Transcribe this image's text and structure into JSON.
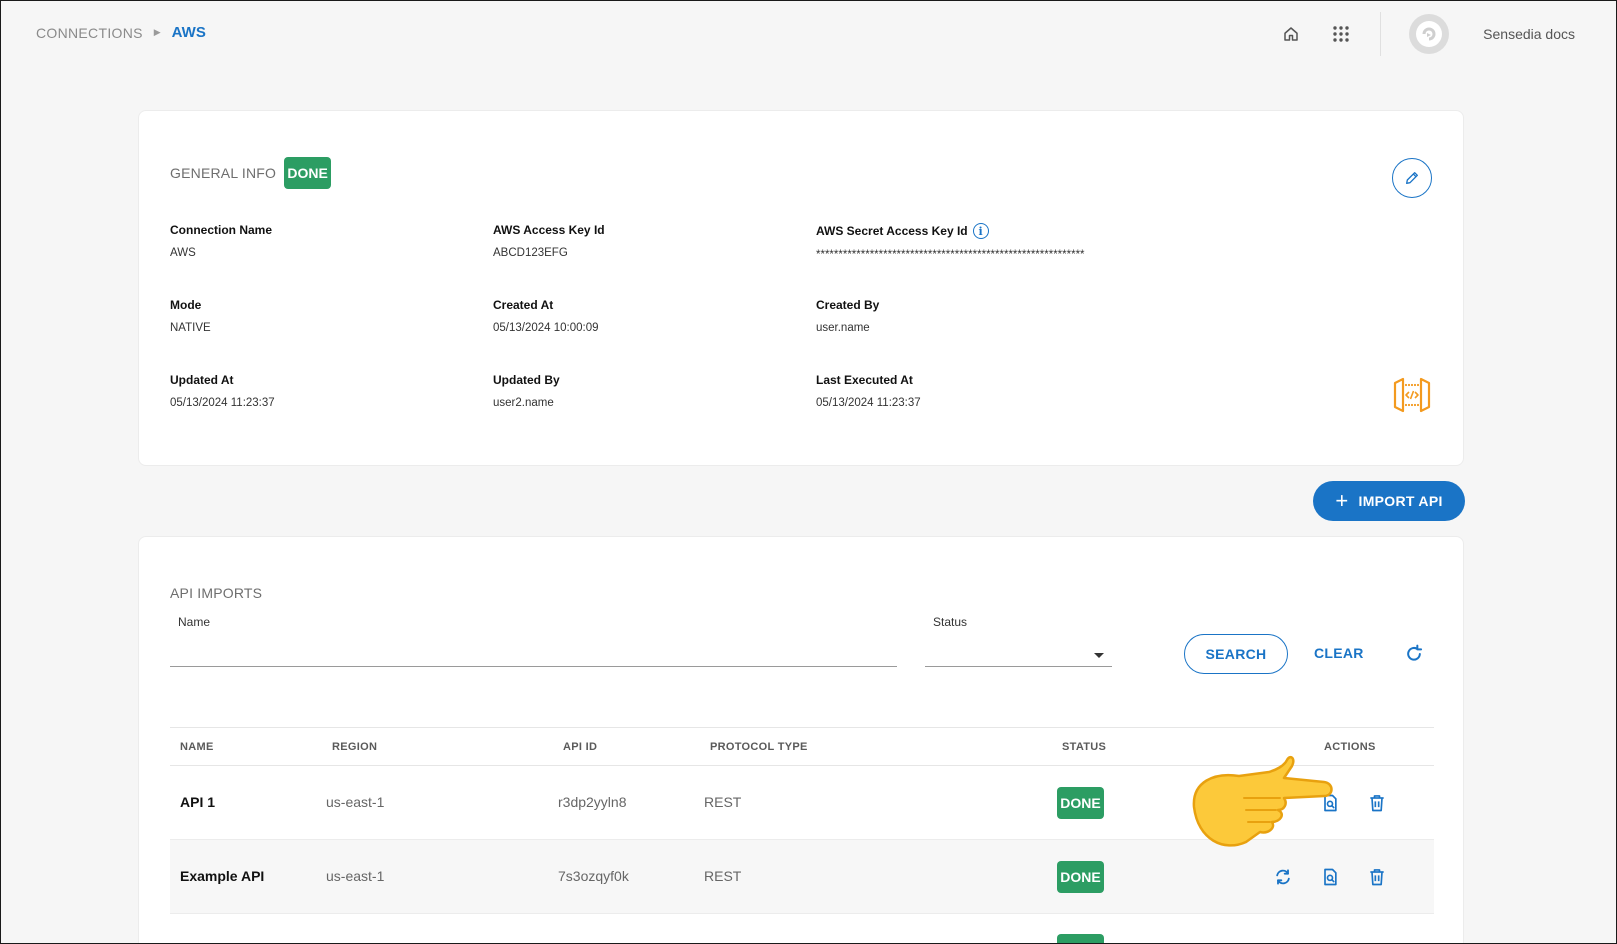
{
  "breadcrumb": {
    "parent": "CONNECTIONS",
    "current": "AWS"
  },
  "topbar": {
    "user_label": "Sensedia docs",
    "icons": [
      "home-icon",
      "apps-grid-icon",
      "avatar-icon"
    ]
  },
  "general_info": {
    "title": "GENERAL INFO",
    "status": "DONE",
    "fields": {
      "connection_name": {
        "label": "Connection Name",
        "value": "AWS"
      },
      "access_key_id": {
        "label": "AWS Access Key Id",
        "value": "ABCD123EFG"
      },
      "secret_access_key": {
        "label": "AWS Secret Access Key Id",
        "value": "************************************************************"
      },
      "mode": {
        "label": "Mode",
        "value": "NATIVE"
      },
      "created_at": {
        "label": "Created At",
        "value": "05/13/2024 10:00:09"
      },
      "created_by": {
        "label": "Created By",
        "value": "user.name"
      },
      "updated_at": {
        "label": "Updated At",
        "value": "05/13/2024 11:23:37"
      },
      "updated_by": {
        "label": "Updated By",
        "value": "user2.name"
      },
      "last_executed_at": {
        "label": "Last Executed At",
        "value": "05/13/2024 11:23:37"
      }
    }
  },
  "import_button": {
    "label": "IMPORT API"
  },
  "api_imports": {
    "title": "API IMPORTS",
    "filters": {
      "name_label": "Name",
      "name_value": "",
      "status_label": "Status",
      "status_value": "",
      "search_label": "SEARCH",
      "clear_label": "CLEAR"
    },
    "columns": [
      "NAME",
      "REGION",
      "API ID",
      "PROTOCOL TYPE",
      "STATUS",
      "ACTIONS"
    ],
    "rows": [
      {
        "name": "API 1",
        "region": "us-east-1",
        "api_id": "r3dp2yyln8",
        "protocol": "REST",
        "status": "DONE"
      },
      {
        "name": "Example API",
        "region": "us-east-1",
        "api_id": "7s3ozqyf0k",
        "protocol": "REST",
        "status": "DONE"
      }
    ]
  },
  "colors": {
    "primary": "#1a74c6",
    "success": "#2c9d63",
    "accent_orange": "#f39a1f"
  }
}
